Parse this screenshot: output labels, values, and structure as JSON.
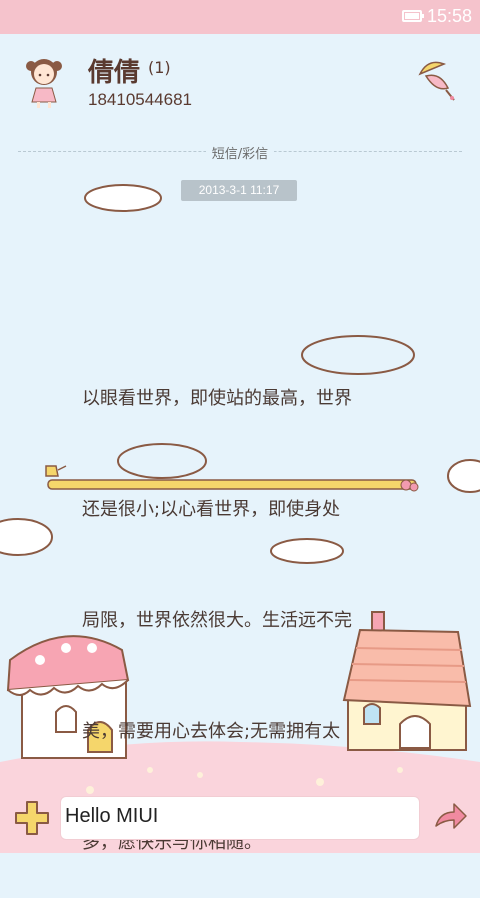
{
  "status_bar": {
    "time": "15:58"
  },
  "contact": {
    "name": "倩倩",
    "count": "(1)",
    "phone": "18410544681"
  },
  "divider": {
    "label": "短信/彩信"
  },
  "message": {
    "timestamp": "2013-3-1 11:17",
    "lines": [
      "以眼看世界，即使站的最高，世界",
      "还是很小;以心看世界，即使身处",
      "局限，世界依然很大。生活远不完",
      "美，需要用心去体会;无需拥有太",
      "多，愿快乐与你相随。"
    ]
  },
  "composer": {
    "text": "Hello MIUI"
  },
  "colors": {
    "status_bar": "#f5c3cc",
    "background": "#e6f3fb",
    "text": "#4a3a34",
    "accent_yellow": "#f5d66b",
    "send_pink": "#f08aa0"
  },
  "icons": {
    "avatar": "girl-avatar-icon",
    "theme": "umbrella-icon",
    "add": "plus-icon",
    "send": "send-arrow-icon"
  }
}
